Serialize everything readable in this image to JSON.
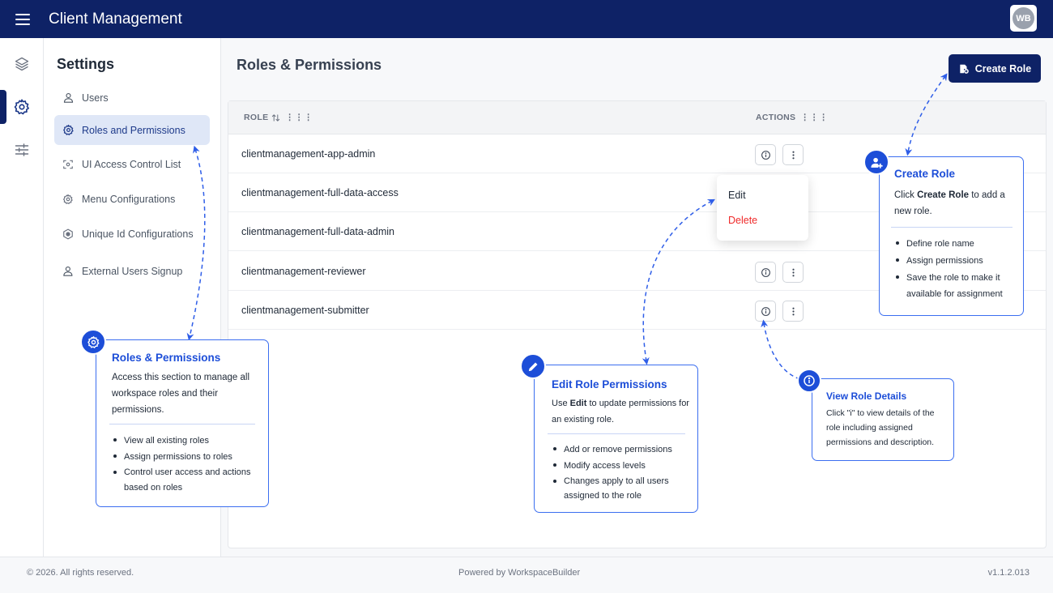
{
  "header": {
    "app_title": "Client Management",
    "avatar_initials": "WB"
  },
  "rail": {
    "items": [
      "layers-icon",
      "gear-icon",
      "sliders-icon"
    ],
    "active_index": 1
  },
  "sidebar": {
    "title": "Settings",
    "items": [
      {
        "label": "Users",
        "icon": "user-icon"
      },
      {
        "label": "Roles and Permissions",
        "icon": "gear-icon",
        "active": true
      },
      {
        "label": "UI Access Control List",
        "icon": "scan-icon"
      },
      {
        "label": "Menu Configurations",
        "icon": "gear-icon"
      },
      {
        "label": "Unique Id Configurations",
        "icon": "hexagon-icon"
      },
      {
        "label": "External Users Signup",
        "icon": "user-plus-icon"
      }
    ]
  },
  "main": {
    "title": "Roles & Permissions",
    "create_button": "Create Role",
    "table": {
      "columns": [
        "ROLE",
        "ACTIONS"
      ],
      "rows": [
        "clientmanagement-app-admin",
        "clientmanagement-full-data-access",
        "clientmanagement-full-data-admin",
        "clientmanagement-reviewer",
        "clientmanagement-submitter"
      ]
    },
    "dropdown": {
      "edit": "Edit",
      "delete": "Delete"
    }
  },
  "callouts": {
    "roles": {
      "title": "Roles & Permissions",
      "desc": "Access this section to manage all workspace roles and their permissions.",
      "bullets": [
        "View all existing roles",
        "Assign permissions to roles",
        "Control user access and actions based on roles"
      ]
    },
    "edit": {
      "title": "Edit Role Permissions",
      "desc_pre": "Use ",
      "desc_bold": "Edit",
      "desc_post": " to update permissions for an existing role.",
      "bullets": [
        "Add or remove permissions",
        "Modify access levels",
        "Changes apply to all users assigned to the role"
      ]
    },
    "view": {
      "title": "View Role Details",
      "desc": "Click \"i\" to view details of the role including assigned permissions and description."
    },
    "create": {
      "title": "Create Role",
      "desc_pre": "Click ",
      "desc_bold": "Create Role",
      "desc_post": " to add a new role.",
      "bullets": [
        "Define role name",
        "Assign permissions",
        "Save the role to make it available for assignment"
      ]
    }
  },
  "footer": {
    "copyright": "© 2026. All rights reserved.",
    "powered": "Powered by WorkspaceBuilder",
    "version": "v1.1.2.013"
  },
  "colors": {
    "navy": "#0e2266",
    "accent": "#1d4ed8",
    "delete": "#ef2a2a",
    "active_bg": "#dfe7f7"
  }
}
